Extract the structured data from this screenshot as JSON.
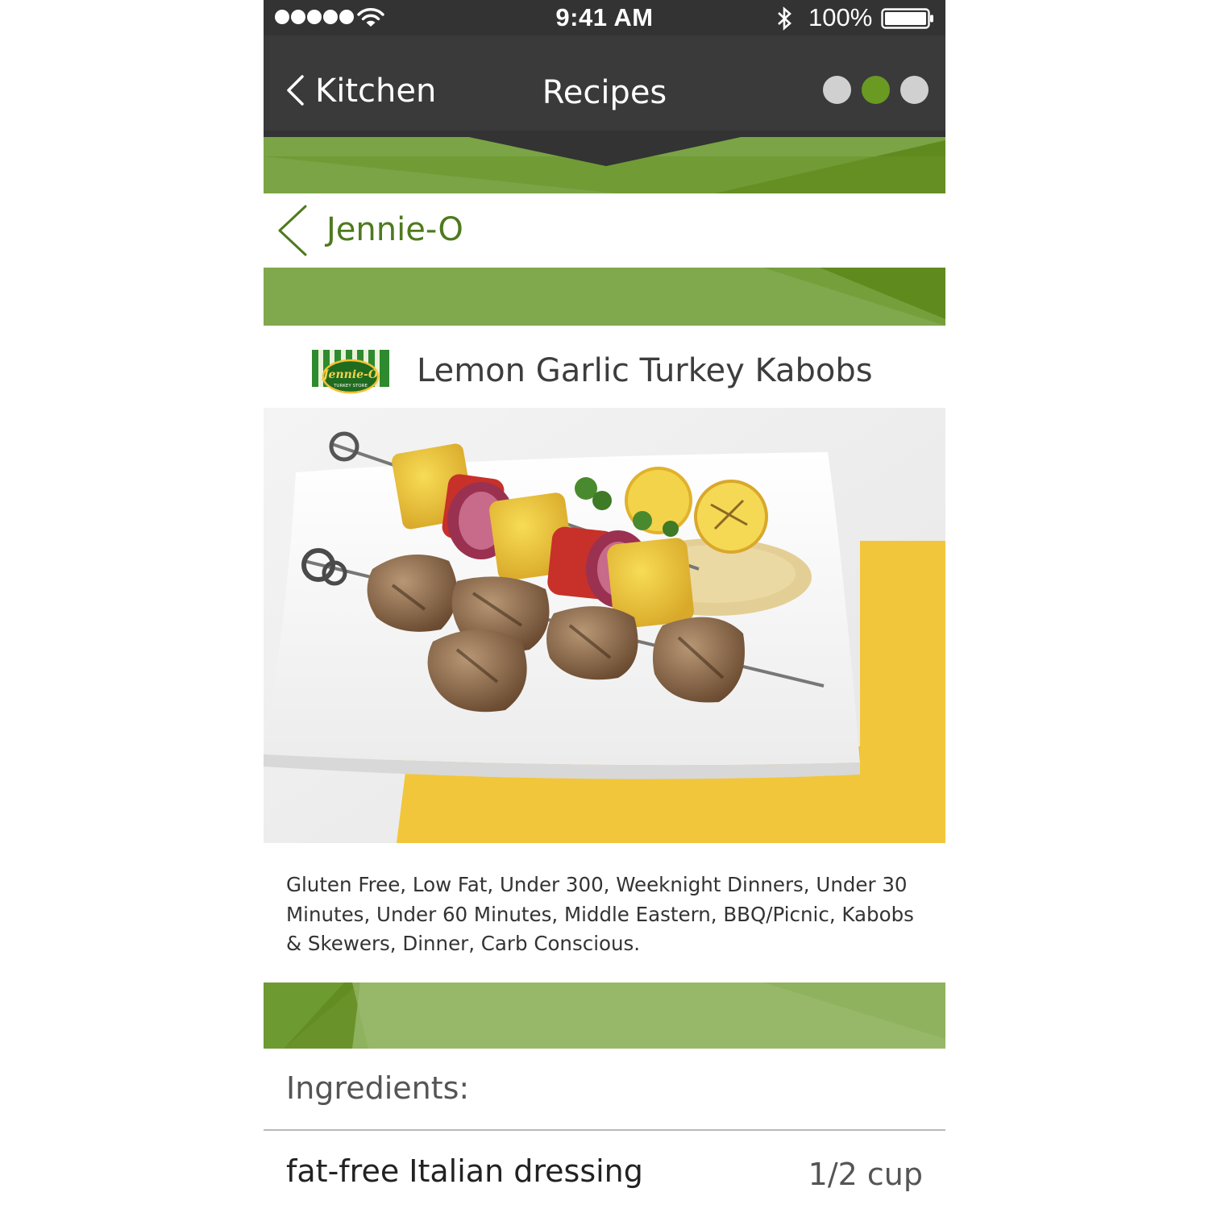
{
  "status_bar": {
    "time": "9:41 AM",
    "battery": "100%",
    "signal_icon": "signal-dots-icon",
    "wifi_icon": "wifi-icon",
    "bluetooth_icon": "bluetooth-icon",
    "battery_icon": "battery-icon"
  },
  "nav": {
    "back_label": "Kitchen",
    "title": "Recipes",
    "page_dots": 3,
    "active_page": 2
  },
  "brand": {
    "back_label": "Jennie-O",
    "logo_text": "Jennie-O",
    "logo_subtext": "TURKEY STORE"
  },
  "recipe": {
    "title": "Lemon Garlic Turkey Kabobs",
    "tags": "Gluten Free, Low Fat, Under 300, Weeknight Dinners, Under 30 Minutes, Under 60 Minutes, Middle Eastern, BBQ/Picnic, Kabobs & Skewers, Dinner, Carb Conscious."
  },
  "ingredients": {
    "heading": "Ingredients:",
    "items": [
      {
        "name": "fat-free Italian dressing",
        "quantity": "1/2 cup"
      }
    ]
  },
  "colors": {
    "status_bar": "#333333",
    "nav_bar": "#3a3a3a",
    "green_dark": "#5f8a1e",
    "green_mid": "#7aa445",
    "green_light": "#98b76a",
    "dot_inactive": "#d0d0d0",
    "dot_active": "#6a9a22",
    "brand_text": "#4e7a1e"
  }
}
